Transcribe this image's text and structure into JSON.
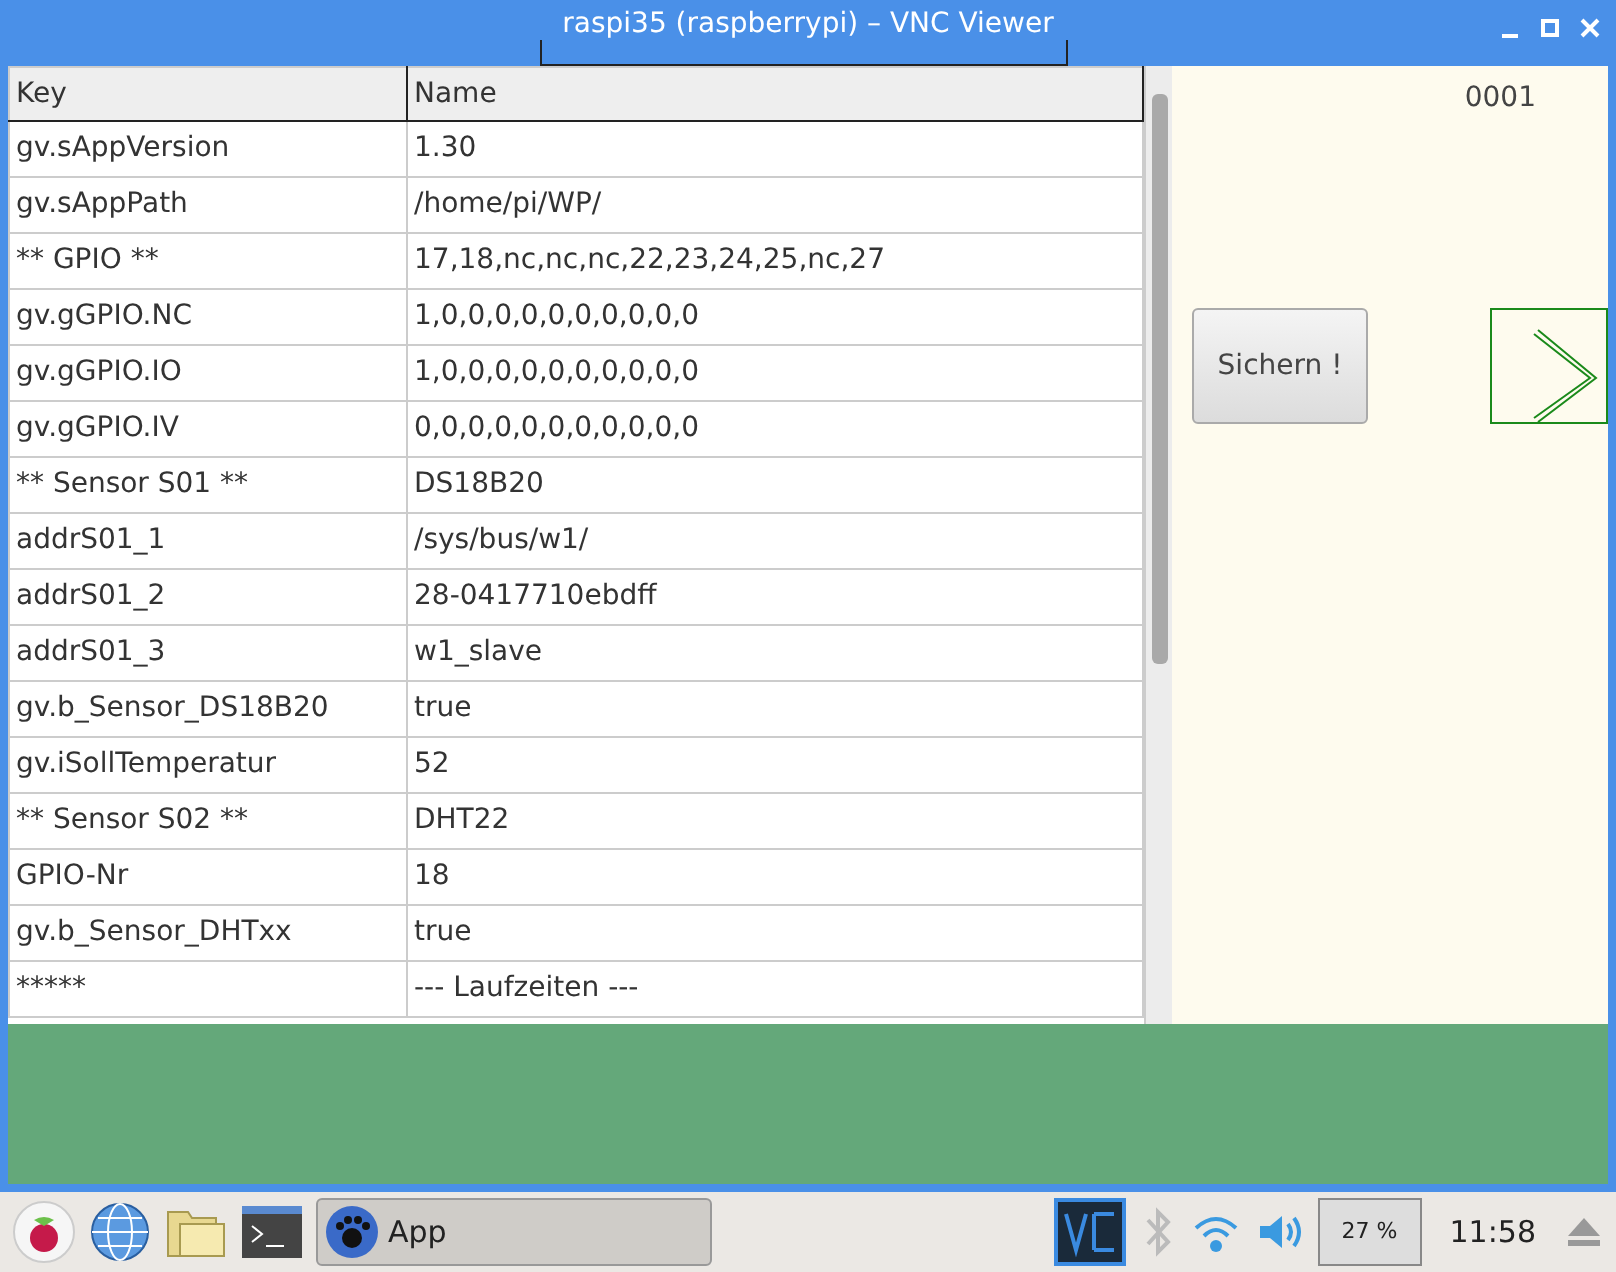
{
  "window": {
    "title": "raspi35 (raspberrypi) – VNC Viewer"
  },
  "table": {
    "columns": [
      "Key",
      "Name"
    ],
    "rows": [
      [
        "gv.sAppVersion",
        "1.30"
      ],
      [
        "gv.sAppPath",
        "/home/pi/WP/"
      ],
      [
        "** GPIO **",
        "17,18,nc,nc,nc,22,23,24,25,nc,27"
      ],
      [
        "gv.gGPIO.NC",
        "1,0,0,0,0,0,0,0,0,0,0"
      ],
      [
        "gv.gGPIO.IO",
        "1,0,0,0,0,0,0,0,0,0,0"
      ],
      [
        "gv.gGPIO.IV",
        "0,0,0,0,0,0,0,0,0,0,0"
      ],
      [
        "** Sensor S01 **",
        "DS18B20"
      ],
      [
        "addrS01_1",
        "/sys/bus/w1/"
      ],
      [
        "addrS01_2",
        "28-0417710ebdff"
      ],
      [
        "addrS01_3",
        "w1_slave"
      ],
      [
        "gv.b_Sensor_DS18B20",
        "true"
      ],
      [
        "gv.iSollTemperatur",
        "52"
      ],
      [
        "** Sensor S02 **",
        "DHT22"
      ],
      [
        "GPIO-Nr",
        "18"
      ],
      [
        "gv.b_Sensor_DHTxx",
        "true"
      ],
      [
        "*****",
        "--- Laufzeiten ---"
      ]
    ]
  },
  "panel": {
    "counter": "0001",
    "save_button": "Sichern !"
  },
  "taskbar": {
    "app_button": "App",
    "cpu": "27 %",
    "clock": "11:58"
  }
}
